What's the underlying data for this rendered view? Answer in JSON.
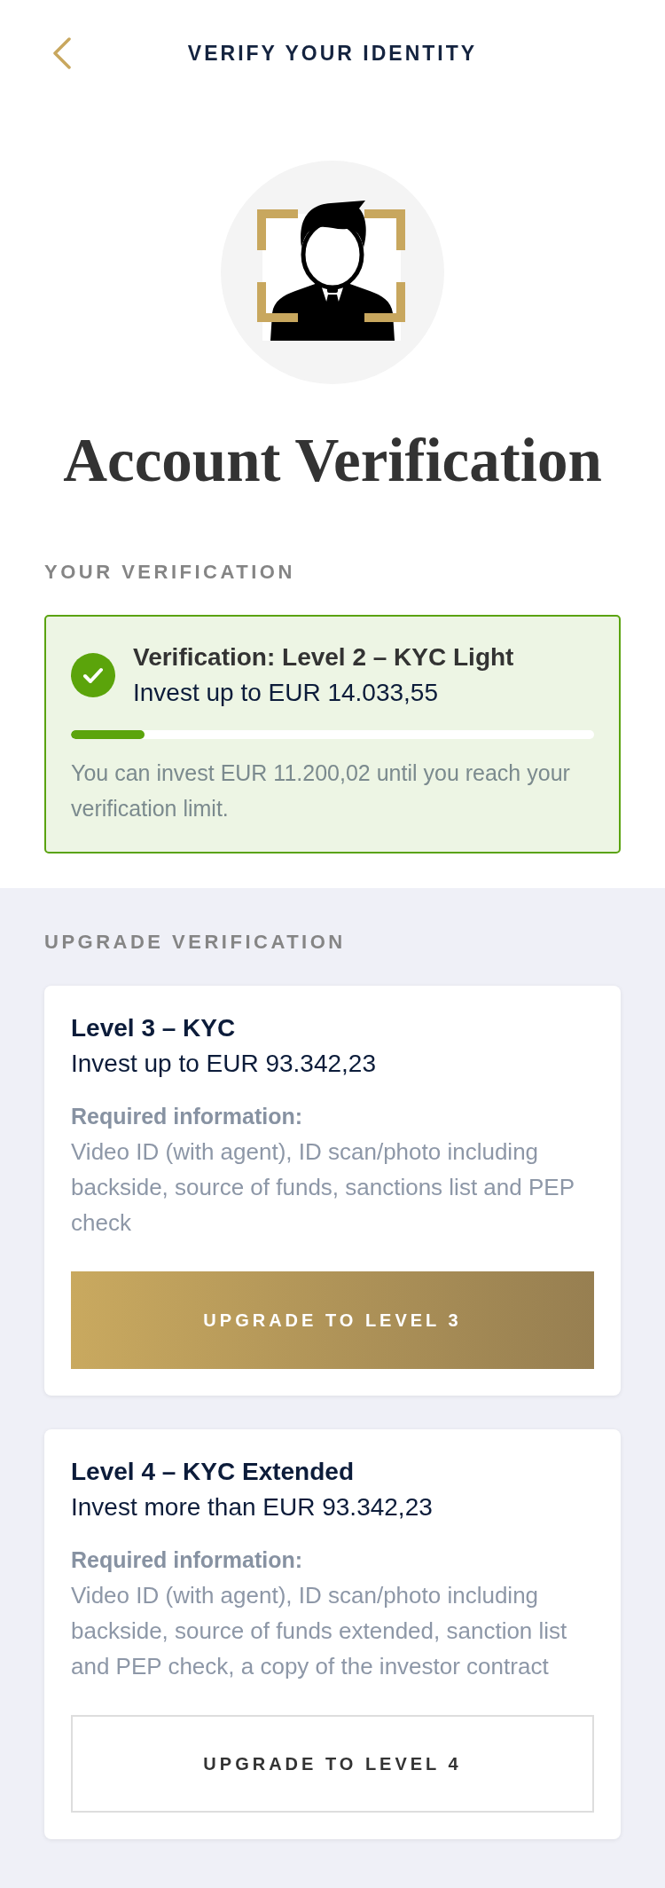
{
  "header": {
    "title": "VERIFY YOUR IDENTITY"
  },
  "hero": {
    "title": "Account Verification"
  },
  "current": {
    "heading": "YOUR VERIFICATION",
    "title": "Verification: Level 2 – KYC Light",
    "limit": "Invest up to EUR 14.033,55",
    "level": 0.14,
    "note": "You can invest EUR 11.200,02 until you reach your verification limit."
  },
  "upgrade": {
    "heading": "UPGRADE VERIFICATION",
    "levels": [
      {
        "title": "Level 3 – KYC",
        "limit": "Invest up to EUR 93.342,23",
        "required_label": "Required information:",
        "required": "Video ID (with agent), ID scan/photo including backside, source of funds, sanctions list and PEP check",
        "button": "UPGRADE TO LEVEL 3",
        "kind": "primary"
      },
      {
        "title": "Level 4 – KYC Extended",
        "limit": "Invest more than EUR 93.342,23",
        "required_label": "Required information:",
        "required": "Video ID (with agent), ID scan/photo including backside, source of funds extended, sanction list and PEP check, a copy of the investor contract",
        "button": "UPGRADE TO LEVEL 4",
        "kind": "outline"
      }
    ]
  }
}
